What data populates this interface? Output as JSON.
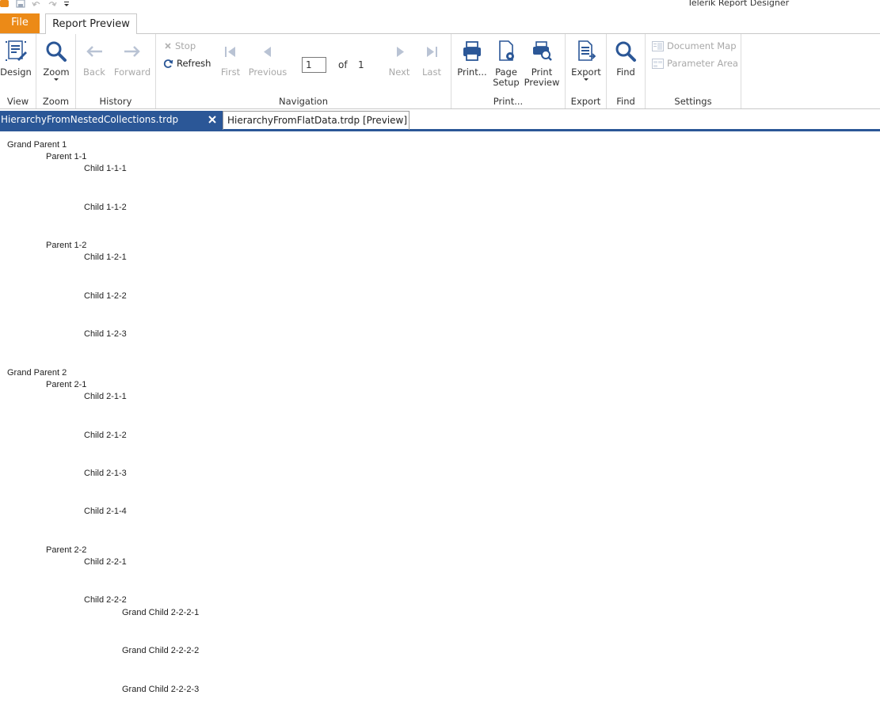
{
  "app": {
    "title": "Telerik Report Designer"
  },
  "ribbon_tabs": {
    "file": "File",
    "report_preview": "Report Preview"
  },
  "ribbon": {
    "view": {
      "design_label": "Design",
      "group_label": "View"
    },
    "zoom": {
      "zoom_label": "Zoom",
      "group_label": "Zoom"
    },
    "history": {
      "back_label": "Back",
      "forward_label": "Forward",
      "group_label": "History"
    },
    "navigation": {
      "stop_label": "Stop",
      "refresh_label": "Refresh",
      "first_label": "First",
      "previous_label": "Previous",
      "page_value": "1",
      "of_label": "of",
      "total_pages": "1",
      "next_label": "Next",
      "last_label": "Last",
      "group_label": "Navigation"
    },
    "print": {
      "print_label": "Print...",
      "page_setup_label1": "Page",
      "page_setup_label2": "Setup",
      "print_preview_label1": "Print",
      "print_preview_label2": "Preview",
      "group_label": "Print..."
    },
    "export": {
      "export_label": "Export",
      "group_label": "Export"
    },
    "find": {
      "find_label": "Find",
      "group_label": "Find"
    },
    "settings": {
      "document_map_label": "Document Map",
      "parameter_area_label": "Parameter Area",
      "group_label": "Settings"
    }
  },
  "doc_tabs": [
    {
      "label": "HierarchyFromNestedCollections.trdp [Preview]"
    },
    {
      "label": "HierarchyFromFlatData.trdp [Preview]"
    }
  ],
  "report": {
    "lines": [
      "Grand Parent 1",
      "Parent 1-1",
      "Child 1-1-1",
      "Child 1-1-2",
      "Parent 1-2",
      "Child 1-2-1",
      "Child 1-2-2",
      "Child 1-2-3",
      "Grand Parent 2",
      "Parent 2-1",
      "Child 2-1-1",
      "Child 2-1-2",
      "Child 2-1-3",
      "Child 2-1-4",
      "Parent 2-2",
      "Child 2-2-1",
      "Child 2-2-2",
      "Grand Child 2-2-2-1",
      "Grand Child 2-2-2-2",
      "Grand Child 2-2-2-3"
    ]
  },
  "colors": {
    "accent": "#2b5797",
    "file_tab": "#ec8a17",
    "disabled": "#a8a8a8"
  }
}
